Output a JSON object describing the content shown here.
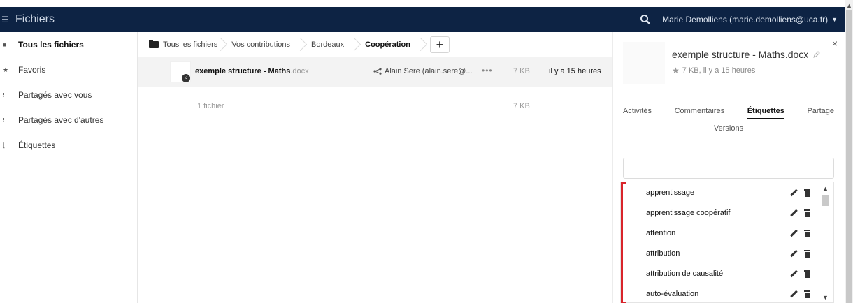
{
  "topbar": {
    "menu_icon": "hamburger-icon",
    "app_title": "Fichiers",
    "search_icon": "search-icon",
    "user_label": "Marie Demolliens (marie.demolliens@uca.fr)",
    "colors": {
      "bar": "#0d2344"
    }
  },
  "sidebar": {
    "items": [
      {
        "label": "Tous les fichiers",
        "icon": "folder-icon",
        "active": true
      },
      {
        "label": "Favoris",
        "icon": "star-icon",
        "active": false
      },
      {
        "label": "Partagés avec vous",
        "icon": "share-icon",
        "active": false
      },
      {
        "label": "Partagés avec d'autres",
        "icon": "share-icon",
        "active": false
      },
      {
        "label": "Étiquettes",
        "icon": "tag-icon",
        "active": false
      }
    ]
  },
  "breadcrumb": {
    "items": [
      "Tous les fichiers",
      "Vos contributions",
      "Bordeaux",
      "Coopération"
    ],
    "add_label": "+"
  },
  "file": {
    "name": "exemple structure - Maths",
    "ext": ".docx",
    "shared_with": "Alain Sere (alain.sere@...",
    "more": "•••",
    "size": "7 KB",
    "modified": "il y a 15 heures"
  },
  "summary": {
    "count": "1 fichier",
    "size": "7 KB"
  },
  "panel": {
    "title": "exemple structure - Maths.docx",
    "meta": "7 KB, il y a 15 heures",
    "close": "×",
    "tabs": [
      "Activités",
      "Commentaires",
      "Étiquettes",
      "Partage"
    ],
    "tab_second_row": "Versions",
    "active_tab": "Étiquettes",
    "tag_input_value": "",
    "tags": [
      "apprentissage",
      "apprentissage coopératif",
      "attention",
      "attribution",
      "attribution de causalité",
      "auto-évaluation"
    ],
    "accent_color": "#d9242b"
  }
}
